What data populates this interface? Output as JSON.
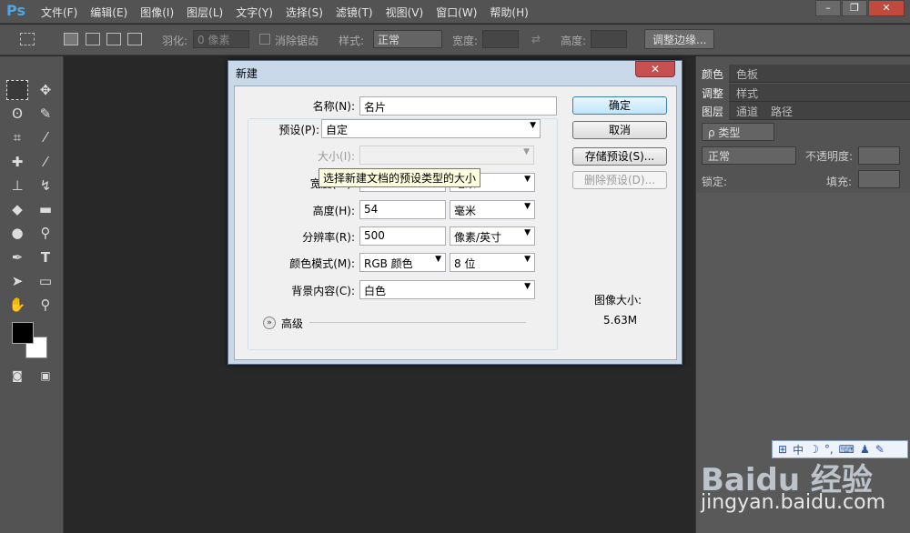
{
  "app": {
    "logo": "Ps",
    "menus": [
      "文件(F)",
      "编辑(E)",
      "图像(I)",
      "图层(L)",
      "文字(Y)",
      "选择(S)",
      "滤镜(T)",
      "视图(V)",
      "窗口(W)",
      "帮助(H)"
    ],
    "window_buttons": [
      "–",
      "❐",
      "✕"
    ]
  },
  "options_bar": {
    "feather_label": "羽化:",
    "feather_value": "0 像素",
    "antialias_label": "消除锯齿",
    "style_label": "样式:",
    "style_value": "正常",
    "width_label": "宽度:",
    "height_label": "高度:",
    "refine_edge": "调整边缘..."
  },
  "right_panel": {
    "tabs1": [
      "颜色",
      "色板"
    ],
    "tabs2": [
      "调整",
      "样式"
    ],
    "tabs3": [
      "图层",
      "通道",
      "路径"
    ],
    "filter_label": "ρ 类型",
    "blend_mode": "正常",
    "opacity_label": "不透明度:",
    "lock_label": "锁定:",
    "fill_label": "填充:"
  },
  "dialog": {
    "title": "新建",
    "close": "✕",
    "name_label": "名称(N):",
    "name_value": "名片",
    "preset_label": "预设(P):",
    "preset_value": "自定",
    "size_label": "大小(I):",
    "width_label": "宽度(W):",
    "width_unit": "毫米",
    "height_label": "高度(H):",
    "height_value": "54",
    "height_unit": "毫米",
    "resolution_label": "分辨率(R):",
    "resolution_value": "500",
    "resolution_unit": "像素/英寸",
    "color_mode_label": "颜色模式(M):",
    "color_mode_value": "RGB 颜色",
    "bit_depth": "8 位",
    "background_label": "背景内容(C):",
    "background_value": "白色",
    "advanced_label": "高级",
    "image_size_label": "图像大小:",
    "image_size_value": "5.63M",
    "ok_button": "确定",
    "cancel_button": "取消",
    "save_preset_button": "存储预设(S)...",
    "delete_preset_button": "删除预设(D)...",
    "tooltip": "选择新建文档的预设类型的大小"
  },
  "watermark": {
    "line1": "Baidu 经验",
    "line2": "jingyan.baidu.com"
  },
  "ime": {
    "label": "中"
  }
}
